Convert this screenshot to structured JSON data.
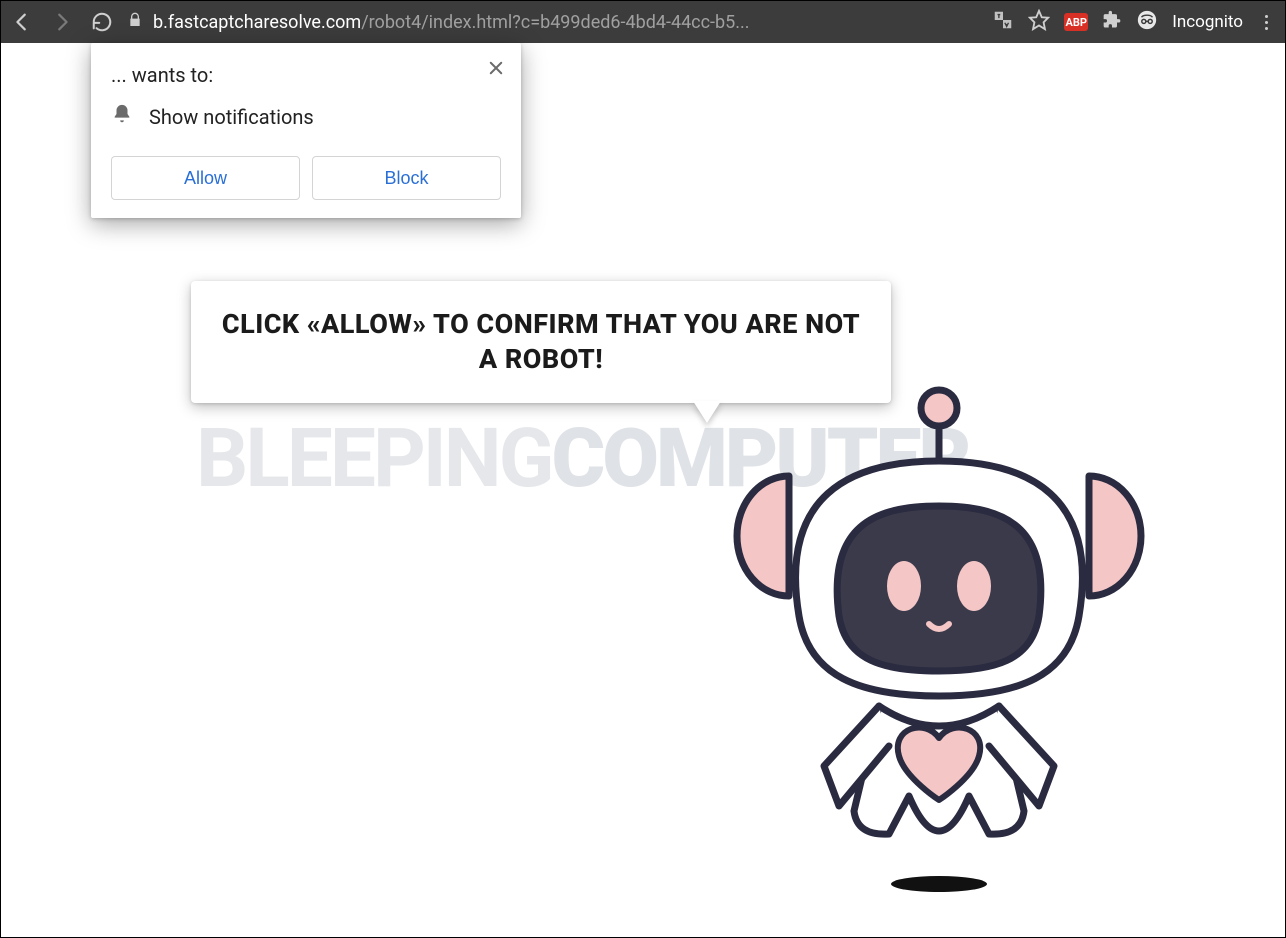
{
  "toolbar": {
    "url_host": "b.fastcaptcharesolve.com",
    "url_rest": "/robot4/index.html?c=b499ded6-4bd4-44cc-b5...",
    "abp_badge": "ABP",
    "incognito_label": "Incognito"
  },
  "permission_prompt": {
    "title": "... wants to:",
    "item_label": "Show notifications",
    "allow_label": "Allow",
    "block_label": "Block"
  },
  "bubble": {
    "text": "CLICK «ALLOW» TO CONFIRM THAT YOU ARE NOT A ROBOT!"
  },
  "watermark": {
    "part1": "BLEEPING",
    "part2": "COMPUTER"
  },
  "colors": {
    "toolbar_bg": "#3c3c3c",
    "link_blue": "#2a6fd6",
    "robot_outline": "#2a2a40",
    "robot_pink": "#f4c6c6",
    "robot_face": "#3b3a4a"
  }
}
